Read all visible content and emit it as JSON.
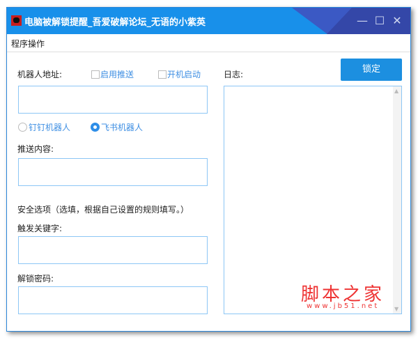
{
  "window": {
    "title": "电脑被解锁提醒_吾爱破解论坛_无语的小紫英",
    "minimize": "—",
    "maximize": "☐",
    "close": "✕"
  },
  "menu": {
    "items": [
      {
        "label": "程序操作"
      }
    ]
  },
  "form": {
    "robot_address_label": "机器人地址:",
    "enable_push_label": "启用推送",
    "autostart_label": "开机启动",
    "robot_address_value": "",
    "radio_dingtalk": "钉钉机器人",
    "radio_feishu": "飞书机器人",
    "selected_robot": "飞书机器人",
    "push_content_label": "推送内容:",
    "push_content_value": "",
    "security_label": "安全选项（选填，根据自己设置的规则填写。）",
    "trigger_keyword_label": "触发关键字:",
    "trigger_keyword_value": "",
    "unlock_password_label": "解锁密码:",
    "unlock_password_value": ""
  },
  "log": {
    "label": "日志:",
    "content": ""
  },
  "lock_button": "锁定",
  "watermark": {
    "text": "脚本之家",
    "url": "www.jb51.net"
  }
}
